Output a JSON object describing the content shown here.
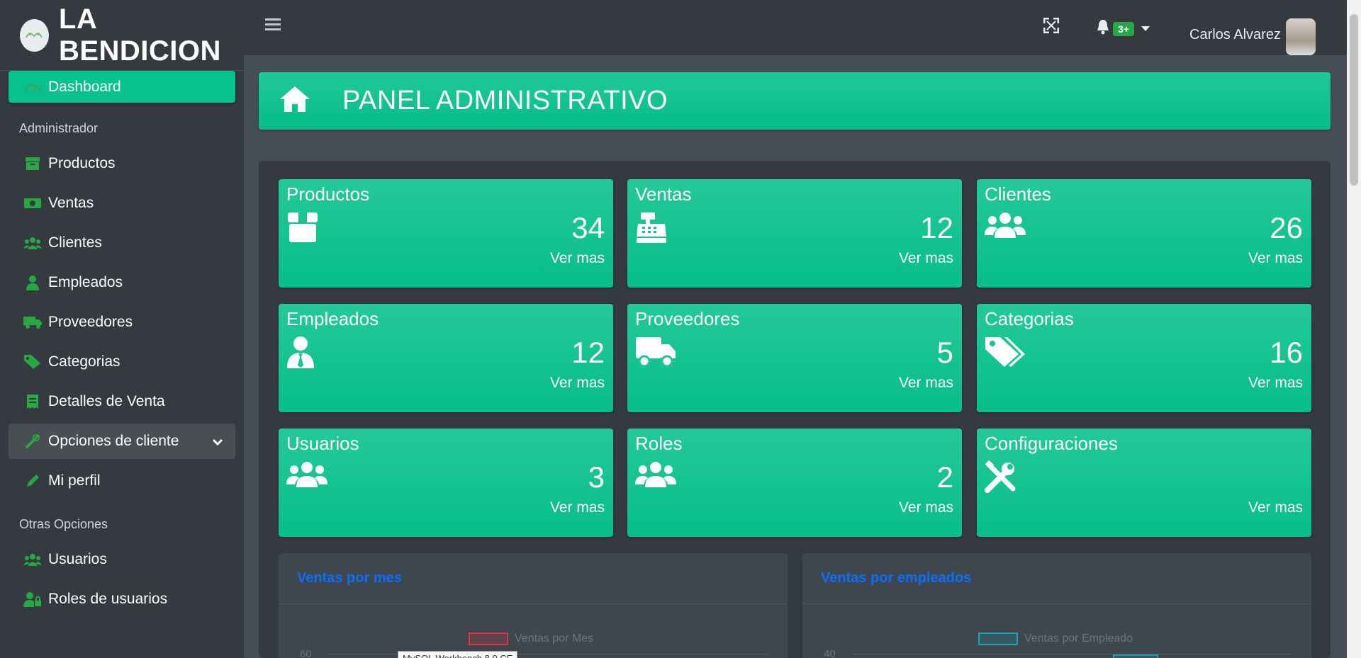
{
  "brand": {
    "name": "LA BENDICION"
  },
  "sidebar": {
    "dashboard": "Dashboard",
    "header_admin": "Administrador",
    "items": [
      {
        "label": "Productos",
        "icon": "box-icon"
      },
      {
        "label": "Ventas",
        "icon": "money-icon"
      },
      {
        "label": "Clientes",
        "icon": "users-icon"
      },
      {
        "label": "Empleados",
        "icon": "user-tie-icon"
      },
      {
        "label": "Proveedores",
        "icon": "truck-icon"
      },
      {
        "label": "Categorias",
        "icon": "tags-icon"
      },
      {
        "label": "Detalles de Venta",
        "icon": "receipt-icon"
      },
      {
        "label": "Opciones de cliente",
        "icon": "tools-icon"
      },
      {
        "label": "Mi perfil",
        "icon": "pencil-icon"
      }
    ],
    "header_other": "Otras Opciones",
    "other_items": [
      {
        "label": "Usuarios",
        "icon": "users-icon"
      },
      {
        "label": "Roles de usuarios",
        "icon": "user-lock-icon"
      }
    ]
  },
  "navbar": {
    "notifications_badge": "3+",
    "user_name": "Carlos Alvarez"
  },
  "header": {
    "title": "PANEL ADMINISTRATIVO"
  },
  "cards": [
    {
      "title": "Productos",
      "count": "34",
      "link": "Ver mas",
      "icon": "box-icon"
    },
    {
      "title": "Ventas",
      "count": "12",
      "link": "Ver mas",
      "icon": "cash-register-icon"
    },
    {
      "title": "Clientes",
      "count": "26",
      "link": "Ver mas",
      "icon": "users-icon"
    },
    {
      "title": "Empleados",
      "count": "12",
      "link": "Ver mas",
      "icon": "user-tie-icon"
    },
    {
      "title": "Proveedores",
      "count": "5",
      "link": "Ver mas",
      "icon": "truck-icon"
    },
    {
      "title": "Categorias",
      "count": "16",
      "link": "Ver mas",
      "icon": "tags-icon"
    },
    {
      "title": "Usuarios",
      "count": "3",
      "link": "Ver mas",
      "icon": "users-icon"
    },
    {
      "title": "Roles",
      "count": "2",
      "link": "Ver mas",
      "icon": "users-icon"
    },
    {
      "title": "Configuraciones",
      "count": "",
      "link": "Ver mas",
      "icon": "tools-icon"
    }
  ],
  "charts": [
    {
      "title": "Ventas por mes",
      "legend": "Ventas por Mes",
      "y_top": "60",
      "legend_color": "#dc3545",
      "tooltip": "MySQL Workbench 8.0 CE"
    },
    {
      "title": "Ventas por empleados",
      "legend": "Ventas por Empleado",
      "y_top": "40",
      "legend_color": "#17a2b8"
    }
  ],
  "colors": {
    "accent": "#07c18e",
    "sidebar": "#343a40",
    "content": "#454d55",
    "chart_title": "#0d6efd"
  }
}
